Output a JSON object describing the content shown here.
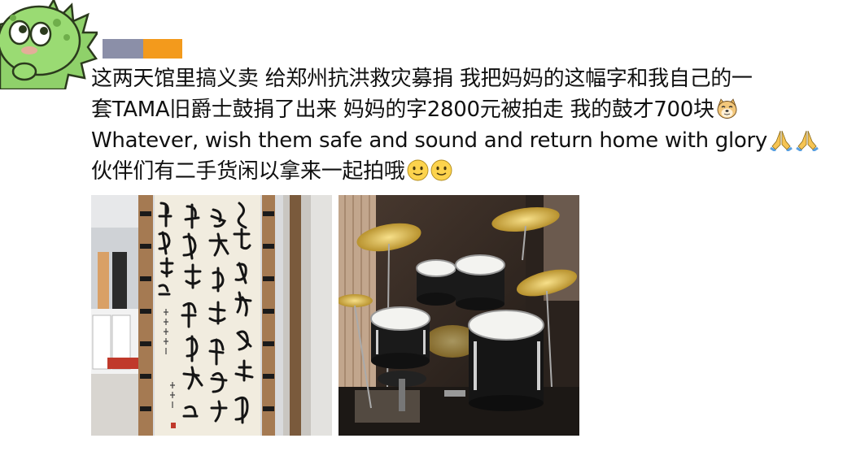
{
  "post": {
    "line1": "这两天馆里搞义卖 给郑州抗洪救灾募捐 我把妈妈的这幅字和我自己的一",
    "line2": "套TAMA旧爵士鼓捐了出来 妈妈的字2800元被拍走 我的鼓才700块",
    "line3": "Whatever, wish them safe and sound and return home with glory",
    "line4": "伙伴们有二手货闲以拿来一起拍哦"
  },
  "icons": {
    "sticker": "green-dinosaur-sticker-icon",
    "doge": "doge-emoji-icon",
    "pray": "praying-hands-emoji-icon",
    "smile": "smile-emoji-icon"
  },
  "colors": {
    "bar_gray": "#8b8fa8",
    "bar_orange": "#f39a1c",
    "dino_green": "#8fd16a"
  },
  "images": {
    "calligraphy": "calligraphy-scroll-photo",
    "drums": "drum-kit-photo"
  }
}
